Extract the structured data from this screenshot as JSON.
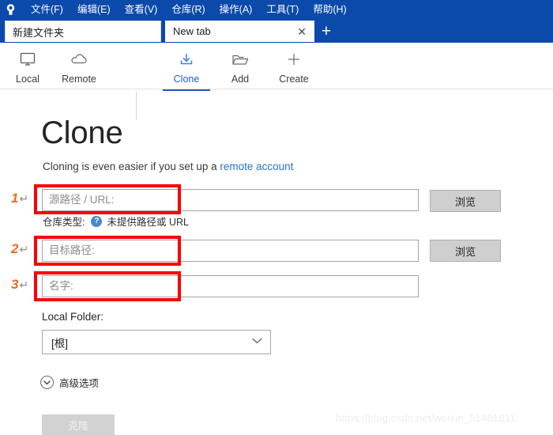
{
  "titlebar": {
    "logo_icon": "sourcetree-logo-icon",
    "menus": [
      {
        "label": "文件(F)"
      },
      {
        "label": "编辑(E)"
      },
      {
        "label": "查看(V)"
      },
      {
        "label": "仓库(R)"
      },
      {
        "label": "操作(A)"
      },
      {
        "label": "工具(T)"
      },
      {
        "label": "帮助(H)"
      }
    ]
  },
  "tabs": {
    "inactive": {
      "label": "新建文件夹"
    },
    "active": {
      "label": "New tab",
      "close_icon": "✕"
    },
    "new_tab_label": "+"
  },
  "toolbar": {
    "items": [
      {
        "label": "Local",
        "icon": "monitor-icon",
        "active": false
      },
      {
        "label": "Remote",
        "icon": "cloud-icon",
        "active": false
      },
      {
        "label": "Clone",
        "icon": "download-icon",
        "active": true
      },
      {
        "label": "Add",
        "icon": "folder-icon",
        "active": false
      },
      {
        "label": "Create",
        "icon": "plus-icon",
        "active": false
      }
    ]
  },
  "main": {
    "title": "Clone",
    "subtitle_prefix": "Cloning is even easier if you set up a ",
    "subtitle_link": "remote account",
    "fields": {
      "source_placeholder": "源路径 / URL:",
      "destination_placeholder": "目标路径:",
      "name_placeholder": "名字:"
    },
    "browse_label": "浏览",
    "repo_type": {
      "label": "仓库类型:",
      "help_icon": "?",
      "status": "未提供路径或 URL"
    },
    "local_folder": {
      "label": "Local Folder:",
      "value": "[根]",
      "chevron_icon": "chevron-down-icon"
    },
    "advanced": {
      "label": "高级选项",
      "icon": "chevron-down-circle-icon"
    },
    "clone_button": "克隆"
  },
  "annotations": {
    "markers": [
      {
        "number": "1",
        "arrow": "↵"
      },
      {
        "number": "2",
        "arrow": "↵"
      },
      {
        "number": "3",
        "arrow": "↵"
      }
    ],
    "box_color": "#fc0000",
    "number_color": "#f06a1e"
  },
  "watermark": "https://blog.csdn.net/weixin_51481811"
}
